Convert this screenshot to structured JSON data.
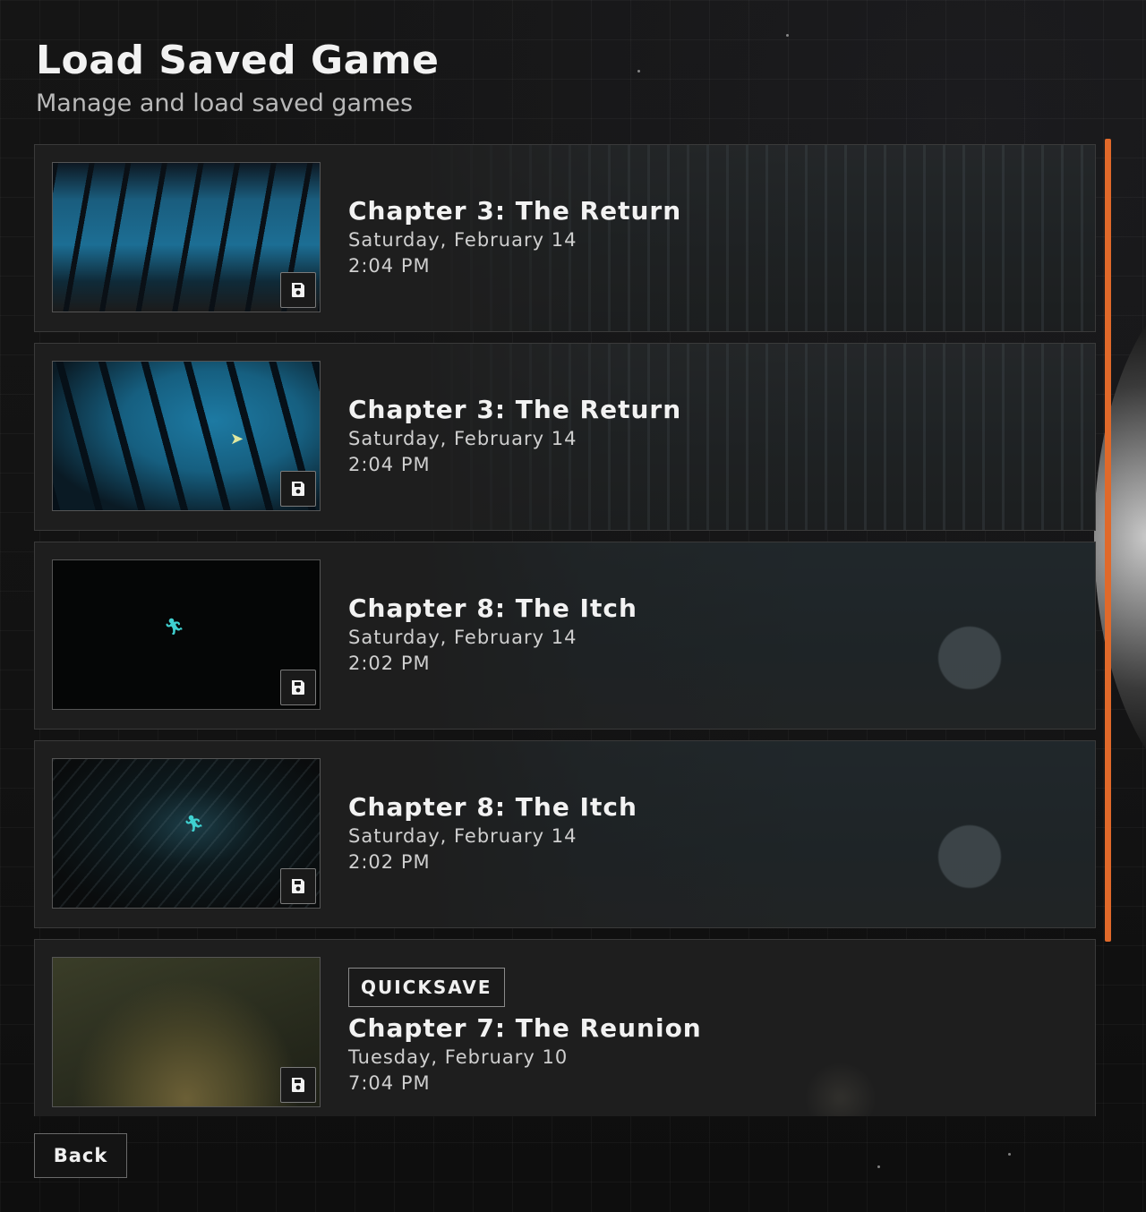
{
  "header": {
    "title": "Load Saved Game",
    "subtitle": "Manage and load saved games"
  },
  "saves": [
    {
      "chapter": "Chapter 3: The Return",
      "date": "Saturday, February 14",
      "time": "2:04 PM",
      "icon": "floppy-disk-icon"
    },
    {
      "chapter": "Chapter 3: The Return",
      "date": "Saturday, February 14",
      "time": "2:04 PM",
      "icon": "floppy-disk-icon"
    },
    {
      "chapter": "Chapter 8: The Itch",
      "date": "Saturday, February 14",
      "time": "2:02 PM",
      "icon": "floppy-disk-icon"
    },
    {
      "chapter": "Chapter 8: The Itch",
      "date": "Saturday, February 14",
      "time": "2:02 PM",
      "icon": "floppy-disk-icon"
    },
    {
      "badge": "QUICKSAVE",
      "chapter": "Chapter 7: The Reunion",
      "date": "Tuesday, February 10",
      "time": "7:04 PM",
      "icon": "floppy-disk-icon"
    }
  ],
  "footer": {
    "back_label": "Back"
  },
  "colors": {
    "accent": "#e0692a",
    "background": "#131313",
    "card": "#1e1e1e"
  }
}
